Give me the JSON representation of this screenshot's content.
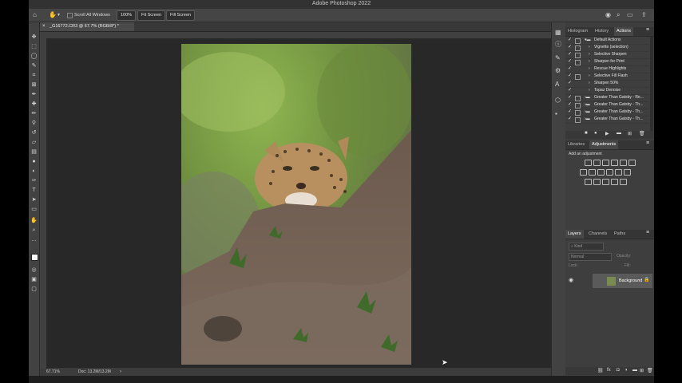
{
  "app": {
    "title": "Adobe Photoshop 2022"
  },
  "options_bar": {
    "scroll_all_windows": "Scroll All Windows",
    "zoom_btn": "100%",
    "fit_screen": "Fit Screen",
    "fill_screen": "Fill Screen"
  },
  "document": {
    "tab_title": "_G16772.CR3 @ 67.7% (RGB/8*) *"
  },
  "status": {
    "zoom": "67.71%",
    "doc_size": "Doc: 13.2M/13.2M"
  },
  "actions_panel": {
    "tabs": [
      "Histogram",
      "History",
      "Actions"
    ],
    "items": [
      "Default Actions",
      "Vignette (selection)",
      "Selective Sharpen",
      "Sharpen for Print",
      "Rescue Highlights",
      "Selective Fill Flash",
      "Sharpen 50%",
      "Topaz Denoise",
      "Greater Than Gatsby - Re...",
      "Greater Than Gatsby - Th...",
      "Greater Than Gatsby - Th...",
      "Greater Than Gatsby - Th..."
    ]
  },
  "adjustments_panel": {
    "tabs": [
      "Libraries",
      "Adjustments"
    ],
    "add_label": "Add an adjustment"
  },
  "layers_panel": {
    "tabs": [
      "Layers",
      "Channels",
      "Paths"
    ],
    "kind_placeholder": "Kind",
    "blend_mode": "Normal",
    "opacity_label": "Opacity:",
    "lock_label": "Lock:",
    "fill_label": "Fill:",
    "layer_name": "Background"
  },
  "colors": {
    "accent": "#1473e6",
    "panel_bg": "#3e3e3e",
    "canvas_bg": "#282828"
  }
}
